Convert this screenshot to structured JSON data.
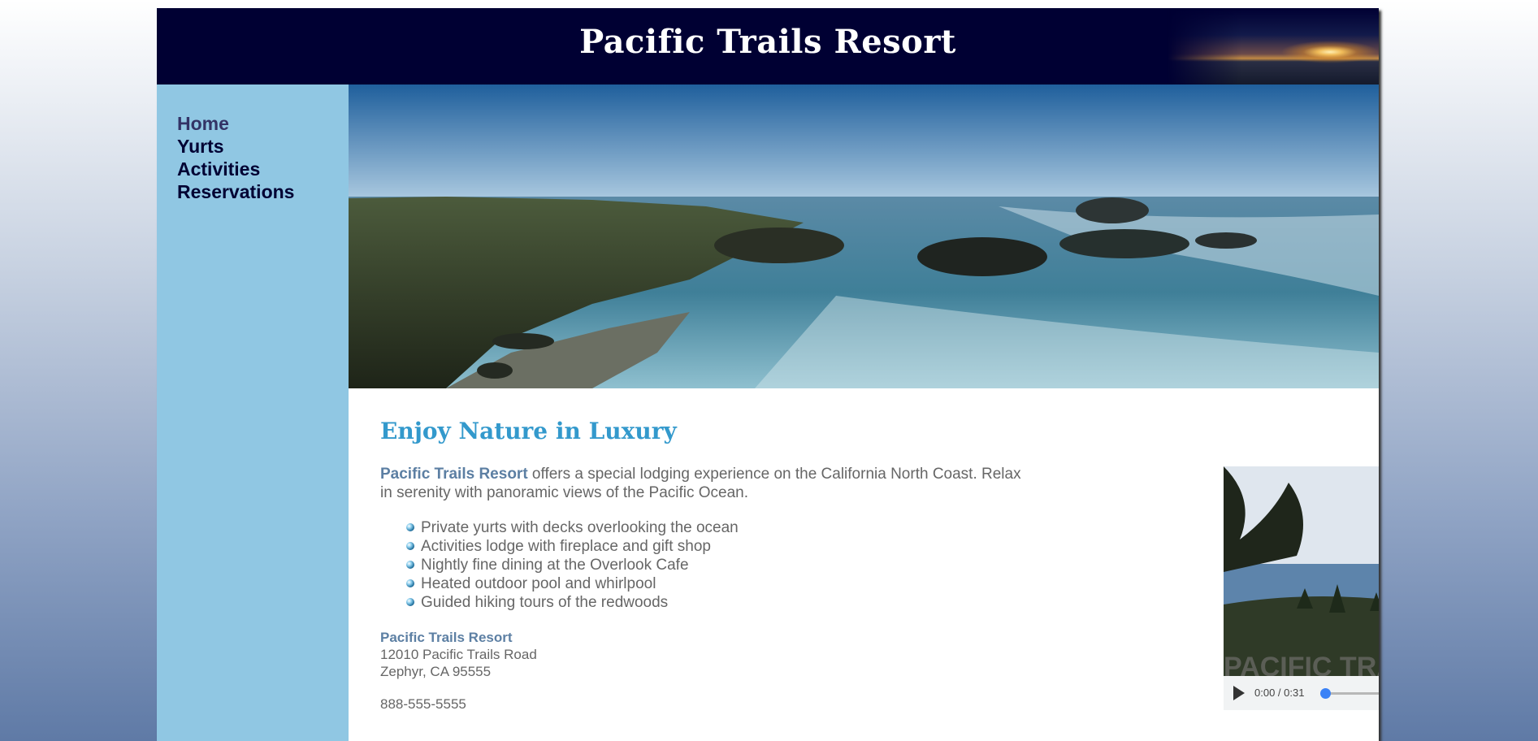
{
  "header": {
    "title": "Pacific Trails Resort"
  },
  "nav": {
    "items": [
      {
        "label": "Home",
        "current": true
      },
      {
        "label": "Yurts",
        "current": false
      },
      {
        "label": "Activities",
        "current": false
      },
      {
        "label": "Reservations",
        "current": false
      }
    ]
  },
  "main": {
    "heading": "Enjoy Nature in Luxury",
    "intro_brand": "Pacific Trails Resort",
    "intro_text": " offers a special lodging experience on the California North Coast. Relax in serenity with panoramic views of the Pacific Ocean.",
    "features": [
      "Private yurts with decks overlooking the ocean",
      "Activities lodge with fireplace and gift shop",
      "Nightly fine dining at the Overlook Cafe",
      "Heated outdoor pool and whirlpool",
      "Guided hiking tours of the redwoods"
    ],
    "address": {
      "name": "Pacific Trails Resort",
      "street": "12010 Pacific Trails Road",
      "city": "Zephyr, CA 95555"
    },
    "phone": "888-555-5555"
  },
  "video": {
    "time": "0:00 / 0:31",
    "overlay_text": "PACIFIC TRAILS RESORT",
    "progress": 0.0,
    "volume": 1.0
  },
  "colors": {
    "header_bg": "#000033",
    "nav_bg": "#90c7e3",
    "heading": "#3399cc",
    "brand": "#5c7fa3",
    "body_text": "#666666"
  }
}
